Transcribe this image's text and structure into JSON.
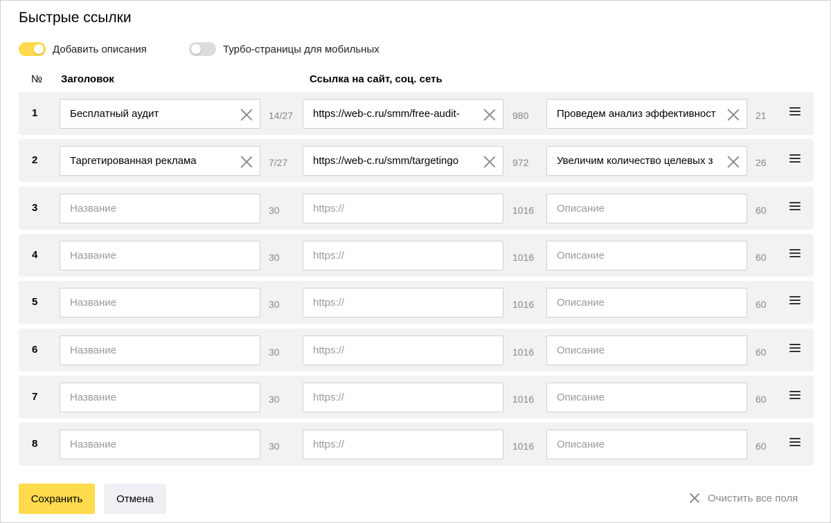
{
  "title": "Быстрые ссылки",
  "toggles": [
    {
      "label": "Добавить описания",
      "on": true
    },
    {
      "label": "Турбо-страницы для мобильных",
      "on": false
    }
  ],
  "headers": {
    "num": "№",
    "title": "Заголовок",
    "link": "Ссылка на сайт, соц. сеть"
  },
  "placeholders": {
    "title": "Название",
    "link": "https://",
    "desc": "Описание"
  },
  "rows": [
    {
      "num": "1",
      "title": "Бесплатный аудит",
      "title_count": "14/27",
      "link": "https://web-c.ru/smm/free-audit-",
      "link_count": "980",
      "desc": "Проведем анализ эффективност",
      "desc_count": "21"
    },
    {
      "num": "2",
      "title": "Таргетированная реклама",
      "title_count": "7/27",
      "link": "https://web-c.ru/smm/targetingo",
      "link_count": "972",
      "desc": "Увеличим количество целевых з",
      "desc_count": "26"
    },
    {
      "num": "3",
      "title": "",
      "title_count": "30",
      "link": "",
      "link_count": "1016",
      "desc": "",
      "desc_count": "60"
    },
    {
      "num": "4",
      "title": "",
      "title_count": "30",
      "link": "",
      "link_count": "1016",
      "desc": "",
      "desc_count": "60"
    },
    {
      "num": "5",
      "title": "",
      "title_count": "30",
      "link": "",
      "link_count": "1016",
      "desc": "",
      "desc_count": "60"
    },
    {
      "num": "6",
      "title": "",
      "title_count": "30",
      "link": "",
      "link_count": "1016",
      "desc": "",
      "desc_count": "60"
    },
    {
      "num": "7",
      "title": "",
      "title_count": "30",
      "link": "",
      "link_count": "1016",
      "desc": "",
      "desc_count": "60"
    },
    {
      "num": "8",
      "title": "",
      "title_count": "30",
      "link": "",
      "link_count": "1016",
      "desc": "",
      "desc_count": "60"
    }
  ],
  "buttons": {
    "save": "Сохранить",
    "cancel": "Отмена",
    "clear_all": "Очистить все поля"
  },
  "colors": {
    "accent": "#ffdb4d",
    "row_bg": "#f2f2f2",
    "cancel_bg": "#eef0f3"
  },
  "icons": {
    "clear": "close-icon",
    "drag": "drag-handle-icon",
    "clear_all": "close-icon"
  }
}
